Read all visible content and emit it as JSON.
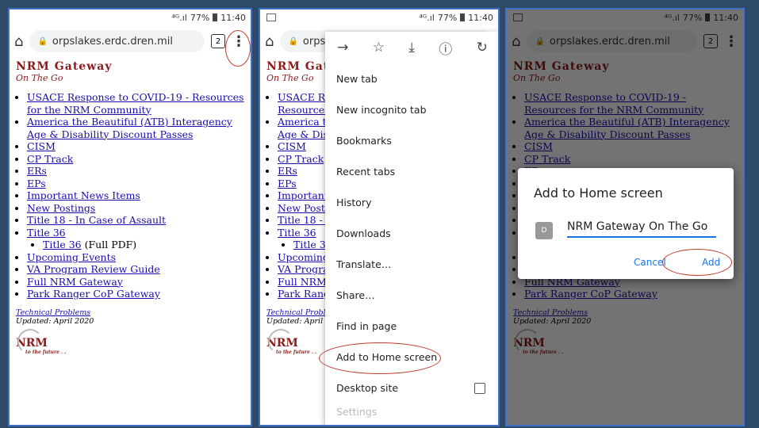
{
  "status": {
    "signal": "⁴ᴳ.ıl",
    "battery": "77%",
    "time": "11:40"
  },
  "browser": {
    "url": "orpslakes.erdc.dren.mil",
    "tab_count": "2"
  },
  "site": {
    "brand_title": "NRM Gateway",
    "brand_subtitle": "On The Go",
    "links": [
      "USACE Response to COVID-19 - Resources for the NRM Community",
      "America the Beautiful (ATB) Interagency Age & Disability Discount Passes",
      "CISM",
      "CP Track",
      "ERs",
      "EPs",
      "Important News Items",
      "New Postings",
      "Title 18 - In Case of Assault",
      "Title 36",
      "Upcoming Events",
      "VA Program Review Guide",
      "Full NRM Gateway",
      "Park Ranger CoP Gateway"
    ],
    "sub_link": "Title 36",
    "sub_suffix": "(Full PDF)",
    "tech_problems": "Technical Problems",
    "updated": "Updated: April 2020",
    "nrm_logo": "NRM",
    "nrm_tagline": "to the future . ."
  },
  "menu": {
    "icons": [
      "arrow-right-icon",
      "star-icon",
      "download-icon",
      "info-icon",
      "refresh-icon"
    ],
    "items": [
      "New tab",
      "New incognito tab",
      "Bookmarks",
      "Recent tabs",
      "History",
      "Downloads",
      "Translate…",
      "Share…",
      "Find in page",
      "Add to Home screen",
      "Desktop site",
      "Settings"
    ]
  },
  "dialog": {
    "title": "Add to Home screen",
    "icon_letter": "D",
    "name_value": "NRM Gateway On The Go",
    "cancel_label": "Cancel",
    "add_label": "Add"
  },
  "colors": {
    "accent": "#1a73e8",
    "highlight_oval": "#c0392b",
    "brand": "#8b1a1a",
    "frame_border": "#3f72c4",
    "background": "#2e4a68"
  }
}
